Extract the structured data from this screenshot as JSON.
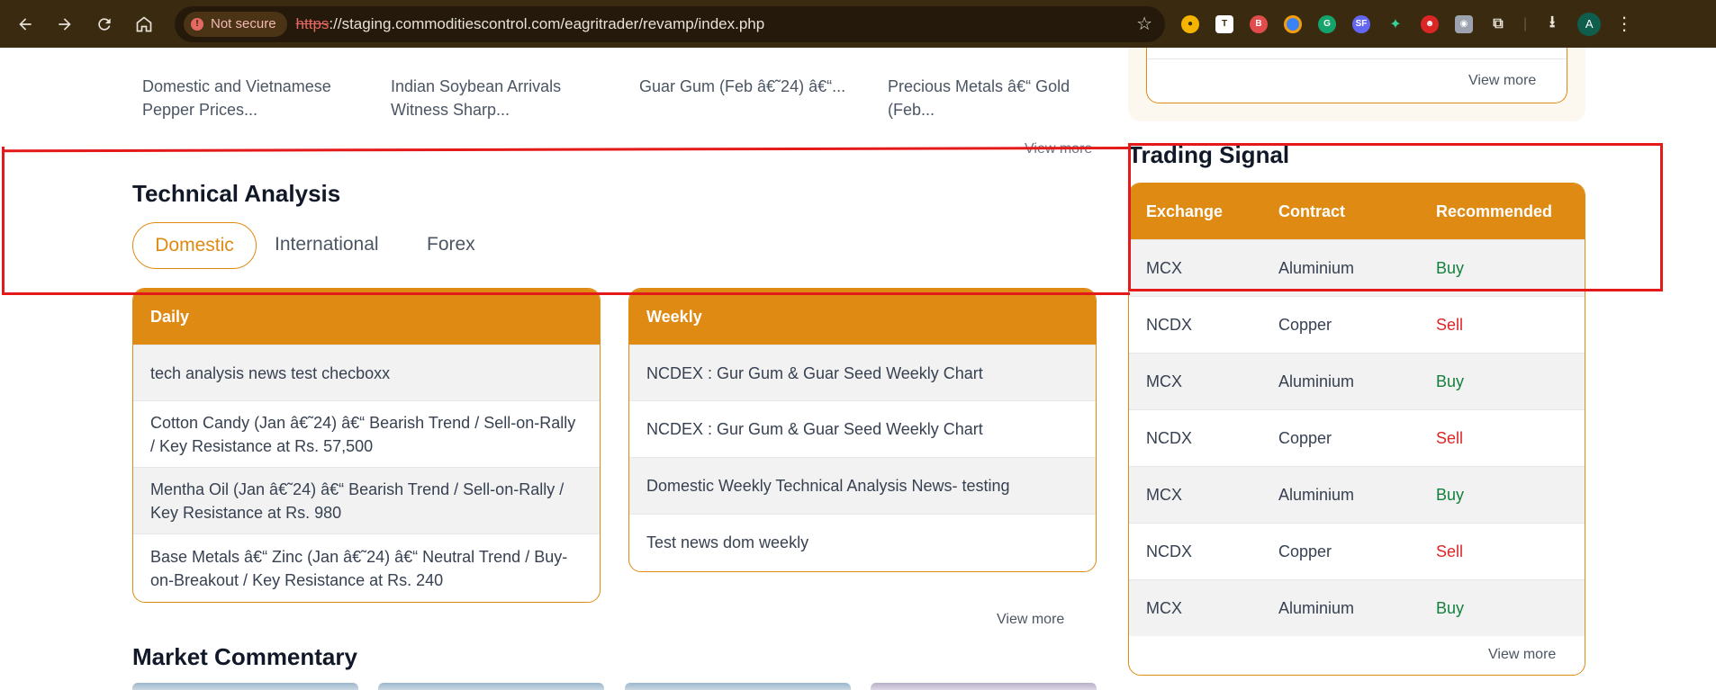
{
  "browser": {
    "nav": {
      "back": "back-arrow",
      "forward": "forward-arrow",
      "reload": "reload",
      "home": "home"
    },
    "security_label": "Not secure",
    "url_protocol": "https",
    "url_rest": "://staging.commoditiescontrol.com/eagritrader/revamp/index.php",
    "profile_initial": "A"
  },
  "news": {
    "items": [
      "Domestic and Vietnamese Pepper Prices...",
      "Indian Soybean Arrivals Witness Sharp...",
      "Guar Gum (Feb â€˜24) â€“...",
      "Precious Metals â€“ Gold (Feb..."
    ],
    "view_more": "View more"
  },
  "technical_analysis": {
    "title": "Technical Analysis",
    "tabs": [
      "Domestic",
      "International",
      "Forex"
    ],
    "active_tab": "Domestic",
    "daily": {
      "header": "Daily",
      "items": [
        "tech analysis news test checboxx",
        "Cotton Candy (Jan â€˜24) â€“ Bearish Trend / Sell-on-Rally / Key Resistance at Rs. 57,500",
        "Mentha Oil (Jan â€˜24) â€“ Bearish Trend / Sell-on-Rally / Key Resistance at Rs. 980",
        "Base Metals â€“ Zinc (Jan â€˜24) â€“ Neutral Trend / Buy-on-Breakout / Key Resistance at Rs. 240"
      ]
    },
    "weekly": {
      "header": "Weekly",
      "items": [
        "NCDEX : Gur Gum & Guar Seed Weekly Chart",
        "NCDEX : Gur Gum & Guar Seed Weekly Chart",
        "Domestic Weekly Technical Analysis News- testing",
        "Test news dom weekly"
      ]
    },
    "view_more": "View more"
  },
  "market_commentary": {
    "title": "Market Commentary"
  },
  "right_top": {
    "view_more": "View more"
  },
  "trading_signal": {
    "title": "Trading Signal",
    "columns": [
      "Exchange",
      "Contract",
      "Recommended"
    ],
    "rows": [
      {
        "exchange": "MCX",
        "contract": "Aluminium",
        "recommended": "Buy"
      },
      {
        "exchange": "NCDX",
        "contract": "Copper",
        "recommended": "Sell"
      },
      {
        "exchange": "MCX",
        "contract": "Aluminium",
        "recommended": "Buy"
      },
      {
        "exchange": "NCDX",
        "contract": "Copper",
        "recommended": "Sell"
      },
      {
        "exchange": "MCX",
        "contract": "Aluminium",
        "recommended": "Buy"
      },
      {
        "exchange": "NCDX",
        "contract": "Copper",
        "recommended": "Sell"
      },
      {
        "exchange": "MCX",
        "contract": "Aluminium",
        "recommended": "Buy"
      }
    ],
    "row_colors": {
      "buy": "#15803d",
      "sell": "#dc2626"
    },
    "view_more": "View more"
  },
  "theme": {
    "accent": "#df8a12",
    "highlight": "#e41a1a"
  }
}
